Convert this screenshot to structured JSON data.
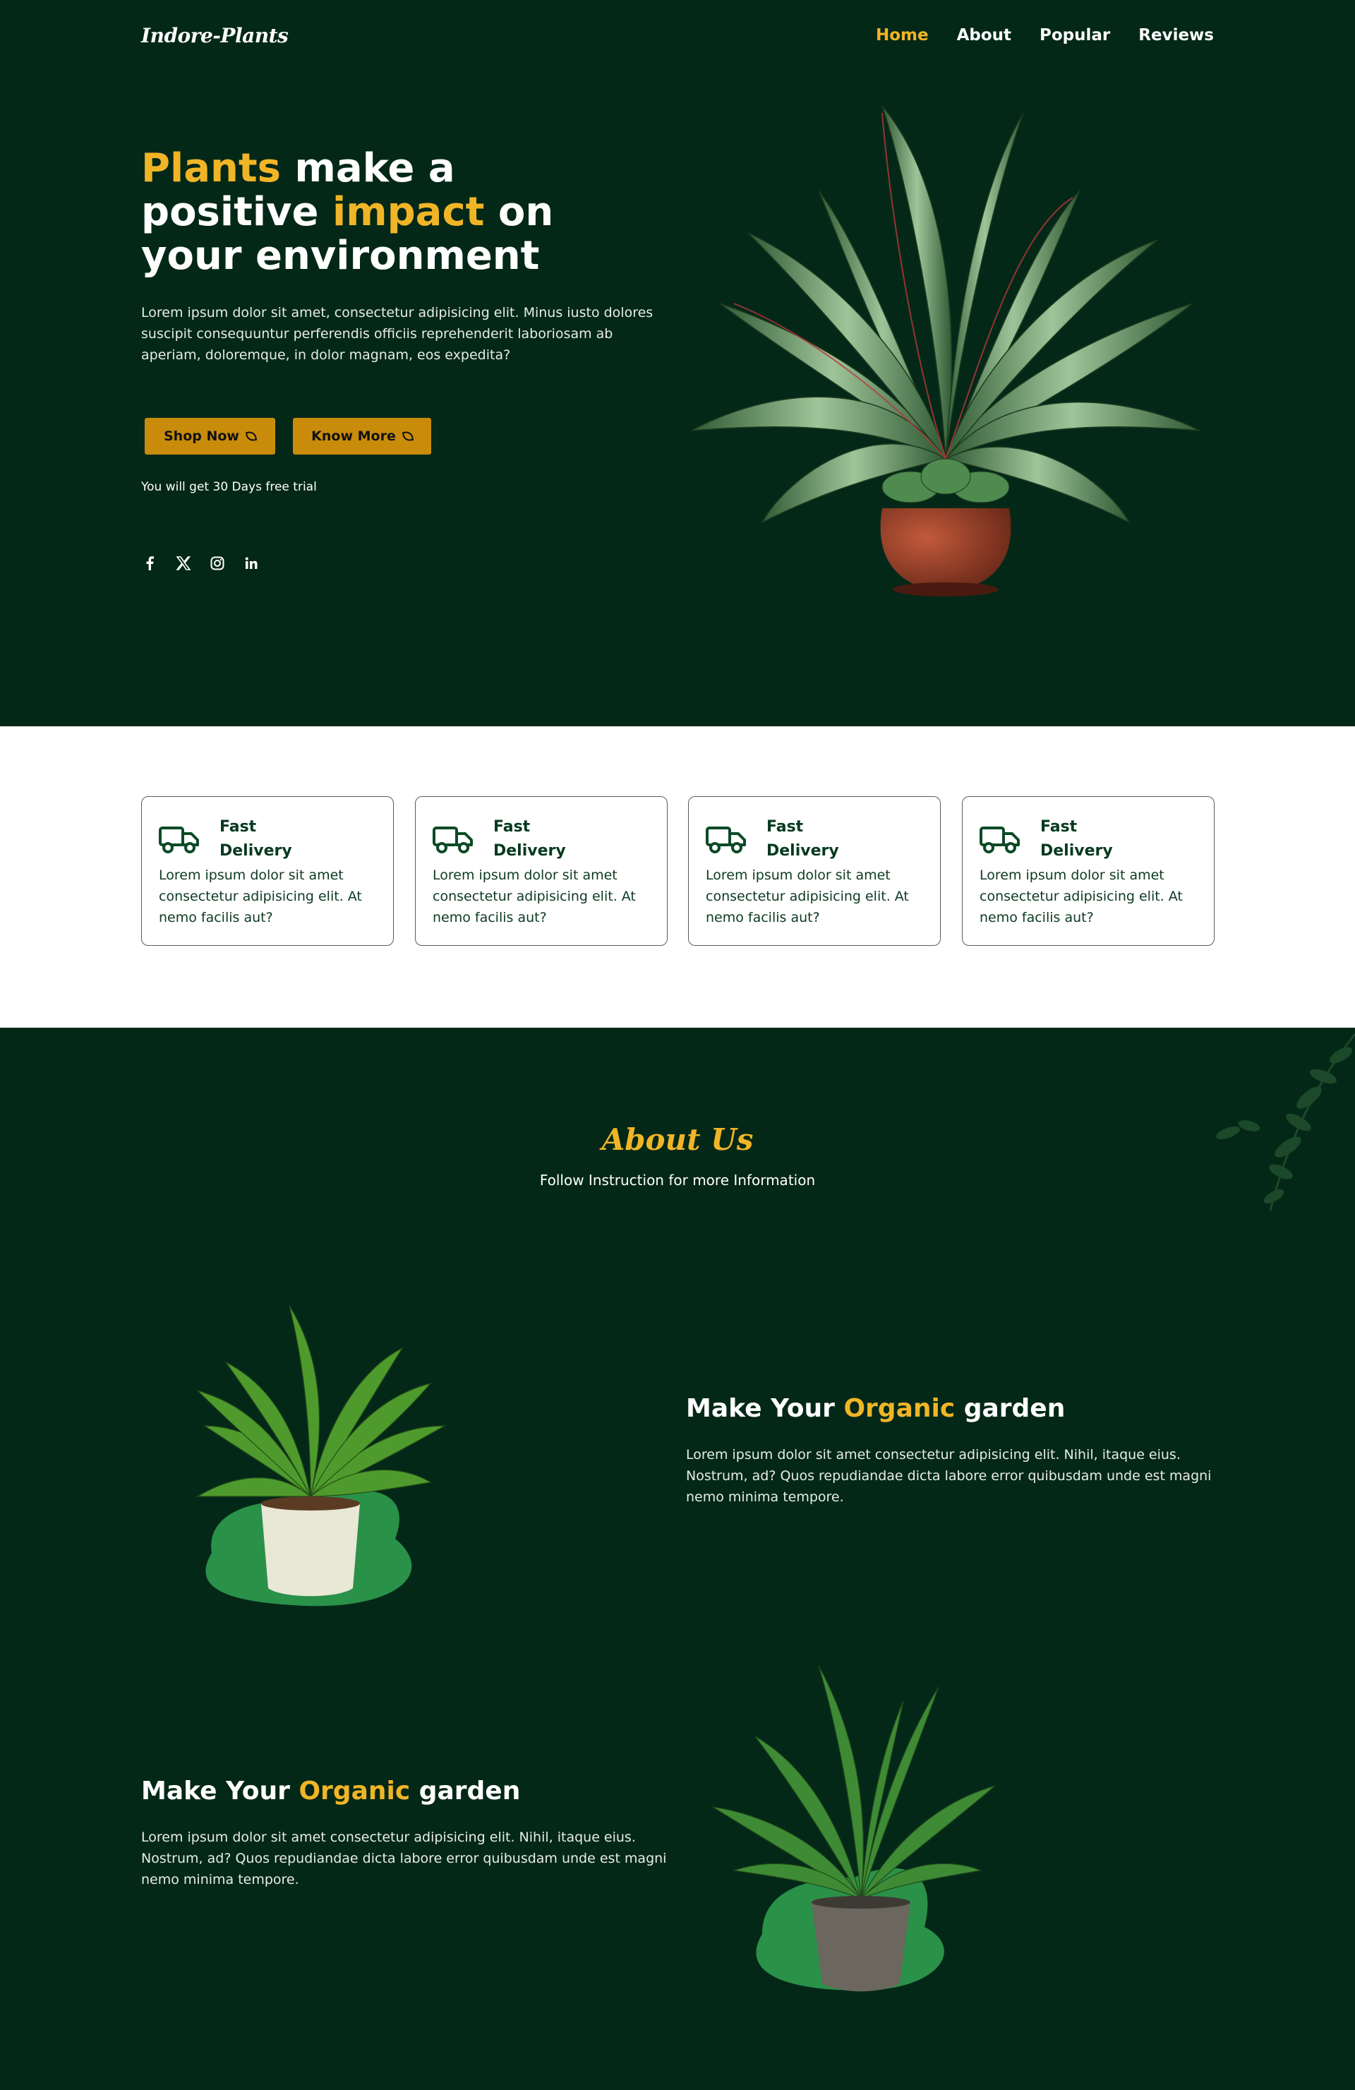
{
  "nav": {
    "logo": "Indore-Plants",
    "items": [
      {
        "label": "Home",
        "active": true
      },
      {
        "label": "About",
        "active": false
      },
      {
        "label": "Popular",
        "active": false
      },
      {
        "label": "Reviews",
        "active": false
      }
    ]
  },
  "hero": {
    "title_part1": "Plants",
    "title_part2": " make a",
    "title_part3": "positive ",
    "title_part4": "impact",
    "title_part5": " on",
    "title_part6": "your environment",
    "description": "Lorem ipsum dolor sit amet, consectetur adipisicing elit. Minus iusto dolores suscipit consequuntur perferendis officiis reprehenderit laboriosam ab aperiam, doloremque, in dolor magnam, eos expedita?",
    "shop_label": "Shop Now",
    "know_label": "Know More",
    "trial_text": "You will get 30 Days free trial",
    "socials": [
      "facebook-icon",
      "x-icon",
      "instagram-icon",
      "linkedin-icon"
    ]
  },
  "features": [
    {
      "title": "Fast Delivery",
      "description": "Lorem ipsum dolor sit amet consectetur adipisicing elit. At nemo facilis aut?"
    },
    {
      "title": "Fast Delivery",
      "description": "Lorem ipsum dolor sit amet consectetur adipisicing elit. At nemo facilis aut?"
    },
    {
      "title": "Fast Delivery",
      "description": "Lorem ipsum dolor sit amet consectetur adipisicing elit. At nemo facilis aut?"
    },
    {
      "title": "Fast Delivery",
      "description": "Lorem ipsum dolor sit amet consectetur adipisicing elit. At nemo facilis aut?"
    }
  ],
  "about": {
    "title": "About Us",
    "subtitle": "Follow Instruction for more Information",
    "rows": [
      {
        "title_a": "Make Your ",
        "title_b": "Organic",
        "title_c": " garden",
        "description": "Lorem ipsum dolor sit amet consectetur adipisicing elit. Nihil, itaque eius. Nostrum, ad? Quos repudiandae dicta labore error quibusdam unde est magni nemo minima tempore."
      },
      {
        "title_a": "Make Your ",
        "title_b": "Organic",
        "title_c": " garden",
        "description": "Lorem ipsum dolor sit amet consectetur adipisicing elit. Nihil, itaque eius. Nostrum, ad? Quos repudiandae dicta labore error quibusdam unde est magni nemo minima tempore."
      }
    ]
  },
  "colors": {
    "background": "#042818",
    "accent": "#f0b527",
    "button": "#c98c0a",
    "blob": "#2a9148"
  }
}
